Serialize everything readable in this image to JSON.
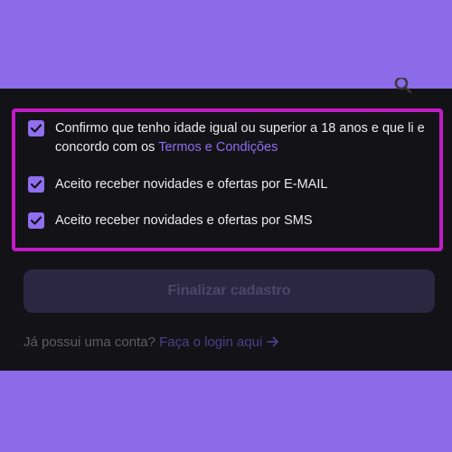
{
  "consents": [
    {
      "checked": true,
      "text": "Confirmo que tenho idade igual ou superior a 18 anos e que li e concordo com os",
      "link": "Termos e Condições"
    },
    {
      "checked": true,
      "text": "Aceito receber novidades e ofertas por E-MAIL"
    },
    {
      "checked": true,
      "text": "Aceito receber novidades e ofertas por SMS"
    }
  ],
  "submit_button": {
    "label": "Finalizar cadastro",
    "state": "disabled"
  },
  "login_prompt": {
    "text": "Já possui uma conta?",
    "link": "Faça o login aqui",
    "arrow_icon": "arrow-right-icon"
  },
  "colors": {
    "page_background": "#8b6be8",
    "panel": "#131216",
    "accent": "#8f6ef0",
    "highlight_border": "#c21cc8",
    "button_bg": "#2b2743"
  }
}
